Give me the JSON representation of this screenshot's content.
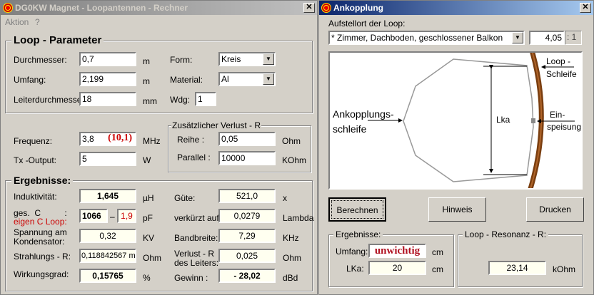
{
  "main_window": {
    "title": "DG0KW  Magnet - Loopantennen - Rechner",
    "menu": [
      "Aktion",
      "?"
    ],
    "loop_parameter": {
      "title": "Loop - Parameter",
      "durchmesser": {
        "label": "Durchmesser:",
        "value": "0,7",
        "unit": "m"
      },
      "umfang": {
        "label": "Umfang:",
        "value": "2,199",
        "unit": "m"
      },
      "leiter": {
        "label": "Leiterdurchmesser:",
        "value": "18",
        "unit": "mm"
      },
      "form": {
        "label": "Form:",
        "value": "Kreis"
      },
      "material": {
        "label": "Material:",
        "value": "Al"
      },
      "wdg": {
        "label": "Wdg:",
        "value": "1"
      }
    },
    "frequenz": {
      "label": "Frequenz:",
      "value": "3,8",
      "band": "(10,1)",
      "unit": "MHz"
    },
    "tx": {
      "label": "Tx -Output:",
      "value": "5",
      "unit": "W"
    },
    "verlust": {
      "title": "Zusätzlicher Verlust - R",
      "reihe": {
        "label": "Reihe :",
        "value": "0,05",
        "unit": "Ohm"
      },
      "parallel": {
        "label": "Parallel :",
        "value": "10000",
        "unit": "KOhm"
      }
    },
    "ergebnisse": {
      "title": "Ergebnisse:",
      "induktivitaet": {
        "label": "Induktivität:",
        "value": "1,645",
        "unit": "µH"
      },
      "kapazitaet": {
        "label1": "ges.  C          :",
        "label2": "eigen C  Loop:",
        "value": "1066",
        "sep": "–",
        "eigen": "1,9",
        "unit": "pF"
      },
      "spannung": {
        "label1": "Spannung am",
        "label2": "Kondensator:",
        "value": "0,32",
        "unit": "KV"
      },
      "strahlung": {
        "label": "Strahlungs - R:",
        "value": "0,118842567 m",
        "unit": "Ohm"
      },
      "wirkungsgrad": {
        "label": "Wirkungsgrad:",
        "value": "0,15765",
        "unit": "%"
      },
      "guete": {
        "label": "Güte:",
        "value": "521,0",
        "unit": "x"
      },
      "verkuerzt": {
        "label": "verkürzt auf:",
        "value": "0,0279",
        "unit": "Lambda"
      },
      "bandbreite": {
        "label": "Bandbreite:",
        "value": "7,29",
        "unit": "KHz"
      },
      "verlust_leiter": {
        "label1": "Verlust - R",
        "label2": "des Leiters:",
        "value": "0,025",
        "unit": "Ohm"
      },
      "gewinn": {
        "label": "Gewinn :",
        "value": "- 28,02",
        "unit": "dBd"
      }
    }
  },
  "coupling_window": {
    "title": "Ankopplung",
    "location_label": "Aufstellort der Loop:",
    "location_value": "* Zimmer, Dachboden, geschlossener Balkon",
    "factor": "4,05",
    "factor_suffix": ": 1",
    "diagram": {
      "ankopplung1": "Ankopplungs-",
      "ankopplung2": "schleife",
      "lka": "Lka",
      "loop1": "Loop -",
      "loop2": "Schleife",
      "ein1": "Ein-",
      "ein2": "speisung"
    },
    "buttons": {
      "berechnen": "Berechnen",
      "hinweis": "Hinweis",
      "drucken": "Drucken"
    },
    "ergebnisse": {
      "title": "Ergebnisse:",
      "umfang_label": "Umfang:",
      "umfang_value": "unwichtig",
      "umfang_unit": "cm",
      "lka_label": "LKa:",
      "lka_value": "20",
      "lka_unit": "cm"
    },
    "resonanz": {
      "title": "Loop - Resonanz - R:",
      "value": "23,14",
      "unit": "kOhm"
    }
  }
}
